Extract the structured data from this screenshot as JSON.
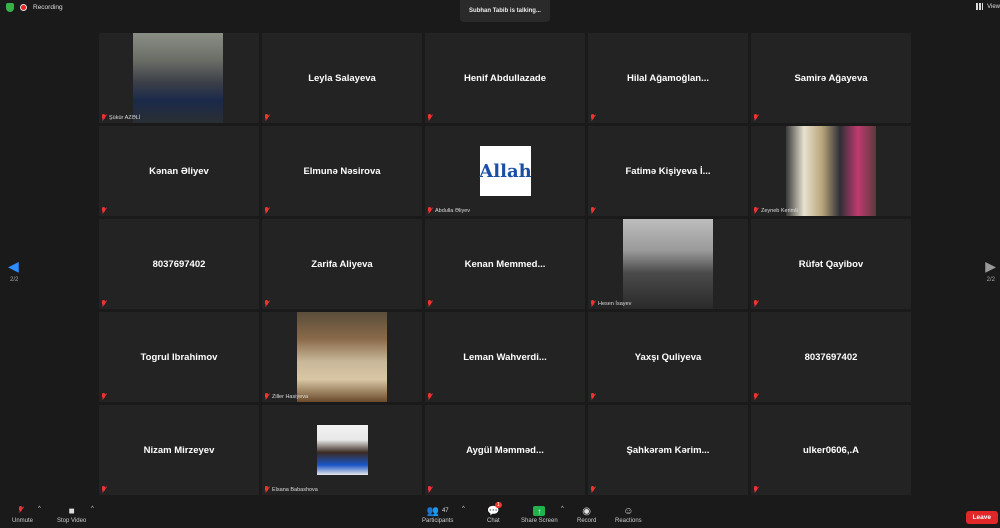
{
  "topbar": {
    "recording": "Recording",
    "talking": "Subhan Tabib is talking...",
    "view": "View"
  },
  "tiles": [
    {
      "name": "",
      "label": "Şükür AZƏLİ",
      "photo": "sukur"
    },
    {
      "name": "Leyla Salayeva",
      "label": ""
    },
    {
      "name": "Henif Abdullazade",
      "label": ""
    },
    {
      "name": "Hilal  Ağamoğlan...",
      "label": ""
    },
    {
      "name": "Samirə Ağayeva",
      "label": ""
    },
    {
      "name": "Kənan Əliyev",
      "label": ""
    },
    {
      "name": "Elmunə Nəsirova",
      "label": ""
    },
    {
      "name": "",
      "label": "Abdulla Əliyev",
      "photo": "allah",
      "photo_text": "Allah"
    },
    {
      "name": "Fatimə  Kişiyeva  İ...",
      "label": ""
    },
    {
      "name": "",
      "label": "Zeyneb Kerimli",
      "photo": "zeyneb"
    },
    {
      "name": "8037697402",
      "label": ""
    },
    {
      "name": "Zarifa Aliyeva",
      "label": ""
    },
    {
      "name": "Kenan  Memmed...",
      "label": ""
    },
    {
      "name": "",
      "label": "Hesen İsayev",
      "photo": "hesen"
    },
    {
      "name": "Rüfət Qayibov",
      "label": ""
    },
    {
      "name": "Togrul Ibrahimov",
      "label": ""
    },
    {
      "name": "",
      "label": "Ziller Hasiyeva",
      "photo": "ziler"
    },
    {
      "name": "Leman  Wahverdi...",
      "label": ""
    },
    {
      "name": "Yaxşı Quliyeva",
      "label": ""
    },
    {
      "name": "8037697402",
      "label": ""
    },
    {
      "name": "Nizam Mirzeyev",
      "label": ""
    },
    {
      "name": "",
      "label": "Elsana Babashova",
      "photo": "elsana"
    },
    {
      "name": "Aygül  Məmməd...",
      "label": ""
    },
    {
      "name": "Şahkərəm  Kərim...",
      "label": ""
    },
    {
      "name": "ulker0606,.A",
      "label": ""
    }
  ],
  "pager": {
    "left": "2/2",
    "right": "2/2"
  },
  "toolbar": {
    "unmute": "Unmute",
    "stop_video": "Stop Video",
    "participants": "Participants",
    "participants_count": "47",
    "chat": "Chat",
    "chat_badge": "1",
    "share_screen": "Share Screen",
    "record": "Record",
    "reactions": "Reactions",
    "leave": "Leave"
  },
  "colors": {
    "background": "#1a1a1a",
    "tile": "#232323",
    "accent": "#2d8cff",
    "share": "#22b24c",
    "leave": "#e02828"
  }
}
